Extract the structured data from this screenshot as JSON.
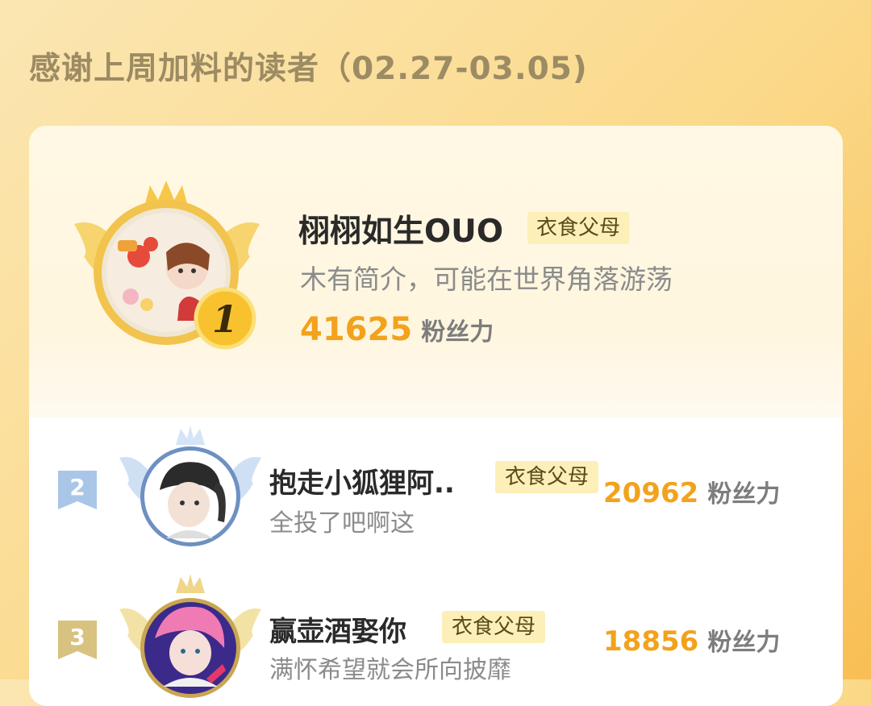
{
  "title": "感谢上周加料的读者（02.27-03.05)",
  "colors": {
    "background": "#fbd98a",
    "accent_number": "#f2a21c",
    "badge_bg": "#fcefb8",
    "rank2_flag": "#a9c6e8",
    "rank3_flag": "#d8c280"
  },
  "readers": [
    {
      "rank": "1",
      "name": "栩栩如生OUO",
      "badge": "衣食父母",
      "intro": "木有简介，可能在世界角落游荡",
      "score": "41625",
      "score_unit": "粉丝力",
      "frame": "gold-crown-wings"
    },
    {
      "rank": "2",
      "name": "抱走小狐狸阿..",
      "badge": "衣食父母",
      "intro": "全投了吧啊这",
      "score": "20962",
      "score_unit": "粉丝力",
      "frame": "silver-crown-wings"
    },
    {
      "rank": "3",
      "name": "赢壶酒娶你",
      "badge": "衣食父母",
      "intro": "满怀希望就会所向披靡",
      "score": "18856",
      "score_unit": "粉丝力",
      "frame": "bronze-crown-wings"
    }
  ]
}
